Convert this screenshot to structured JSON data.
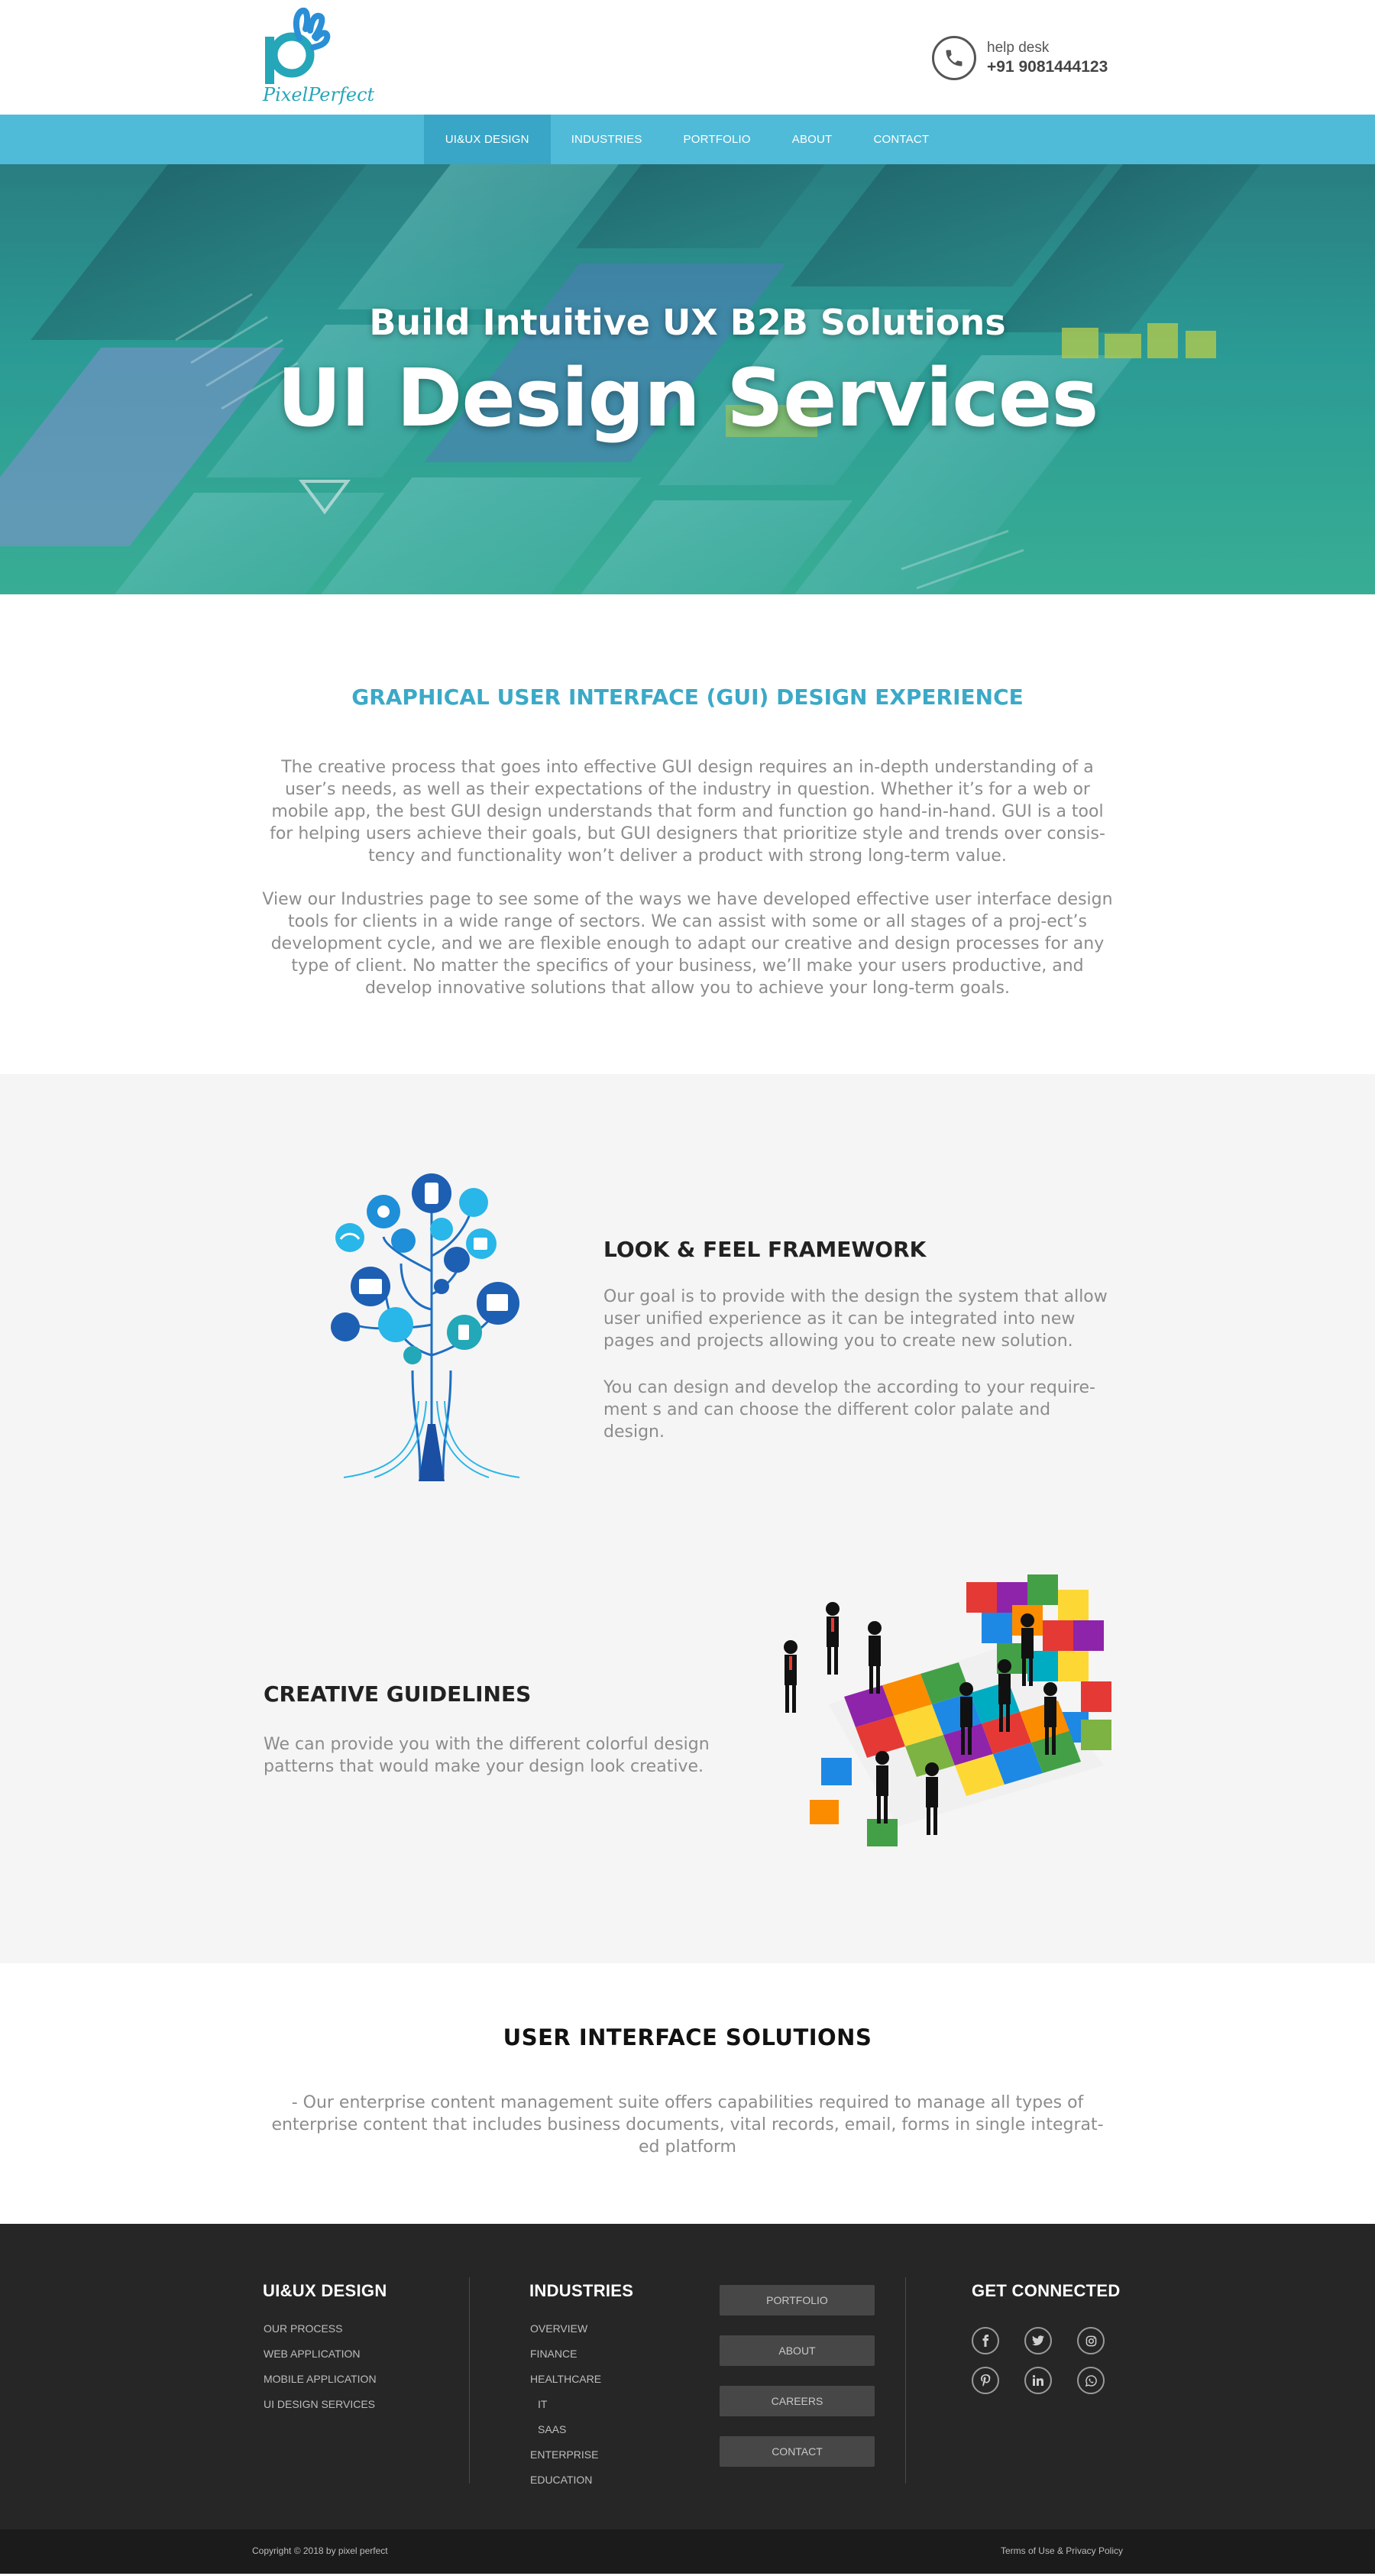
{
  "header": {
    "logo_text": "PixelPerfect",
    "helpdesk_label": "help desk",
    "helpdesk_number": "+91 9081444123"
  },
  "nav": {
    "items": [
      "UI&UX DESIGN",
      "INDUSTRIES",
      "PORTFOLIO",
      "ABOUT",
      "CONTACT"
    ],
    "active_index": 0
  },
  "hero": {
    "subtitle": "Build Intuitive UX B2B Solutions",
    "title": "UI Design Services"
  },
  "gui_section": {
    "heading": "GRAPHICAL USER INTERFACE (GUI) DESIGN EXPERIENCE",
    "paragraph1": "The creative process that goes into effective GUI design requires an in-depth understanding of a user’s needs, as well as their expectations of the industry in question. Whether it’s for a web or mobile app, the best GUI design understands that form and function go hand-in-hand. GUI is a tool for helping users achieve their goals, but GUI designers that prioritize style and trends over consis-tency and functionality won’t deliver a product with strong long-term value.",
    "paragraph2": "View our Industries page to see some of the ways we have developed effective user interface design tools for clients in a wide range of sectors. We can assist with some or all stages of a proj-ect’s development cycle, and we are flexible enough to adapt our creative and design processes for any type of client. No matter the specifics of your business, we’ll make your users productive, and develop innovative solutions that allow you to achieve your long-term goals."
  },
  "features": {
    "look_feel": {
      "title": "LOOK & FEEL FRAMEWORK",
      "paragraph1": "Our goal is to provide with the design the system that allow user unified experience as it can be integrated into new pages and projects allowing you to create new solution.",
      "paragraph2": "You can design and develop the according to your require-ment s and can choose the different color palate and design."
    },
    "creative": {
      "title": "CREATIVE GUIDELINES",
      "paragraph": "We can provide you with the different colorful design patterns that would make your design look creative."
    }
  },
  "solutions": {
    "title": "USER INTERFACE SOLUTIONS",
    "text": "-        Our enterprise content management suite offers capabilities required to manage all types of enterprise content that includes business documents, vital records, email, forms in single integrat-ed platform"
  },
  "footer": {
    "col1": {
      "title": "UI&UX DESIGN",
      "links": [
        "OUR PROCESS",
        "WEB APPLICATION",
        "MOBILE APPLICATION",
        "UI DESIGN SERVICES"
      ]
    },
    "col2": {
      "title": "INDUSTRIES",
      "links": [
        "OVERVIEW",
        "FINANCE",
        "HEALTHCARE",
        "IT",
        "SAAS",
        "ENTERPRISE",
        "EDUCATION"
      ]
    },
    "buttons": [
      "PORTFOLIO",
      "ABOUT",
      "CAREERS",
      "CONTACT"
    ],
    "connect": {
      "title": "GET CONNECTED",
      "icons": [
        "facebook-icon",
        "twitter-icon",
        "instagram-icon",
        "pinterest-icon",
        "linkedin-icon",
        "whatsapp-icon"
      ]
    },
    "copyright": "Copyright © 2018 by pixel perfect",
    "terms": "Terms of Use & Privacy Policy"
  },
  "colors": {
    "brand_teal": "#25a6b9",
    "nav_bg": "#4fbbd8",
    "nav_active": "#3aa6c7",
    "heading_blue": "#3ba9c7",
    "footer_bg": "#262626"
  }
}
